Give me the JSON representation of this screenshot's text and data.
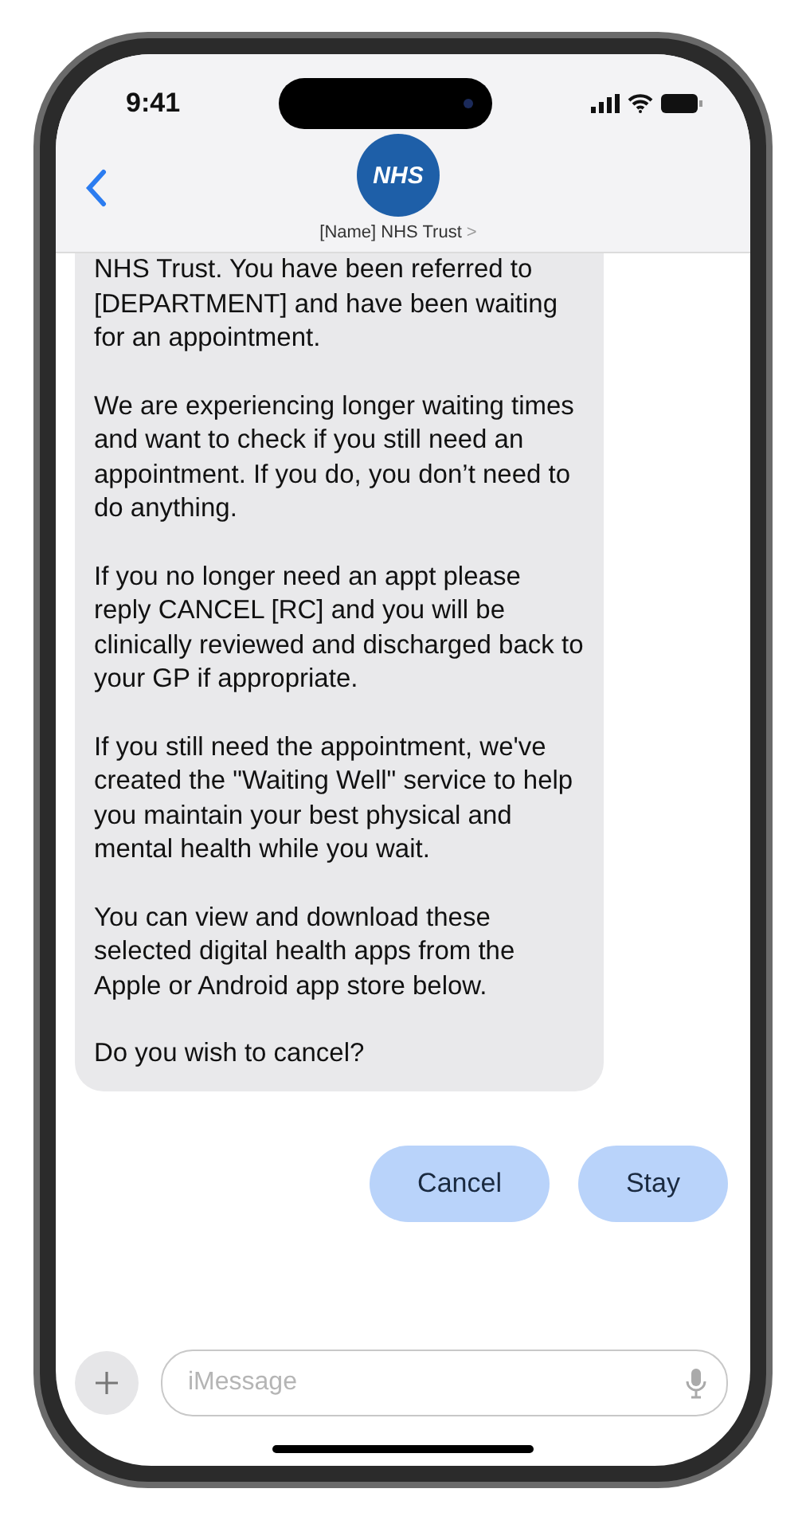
{
  "status_bar": {
    "time": "9:41"
  },
  "header": {
    "avatar_text": "NHS",
    "contact": "[Name] NHS Trust",
    "chevron": ">"
  },
  "message": {
    "paragraphs": [
      "NHS Trust. You have been referred to [DEPARTMENT] and have been waiting for an appointment.",
      "We are experiencing longer waiting times and want to check if you still need an appointment. If you do, you don’t need to do anything.",
      "If you no longer need an appt please reply CANCEL [RC] and you will be clinically reviewed and discharged back to your GP if appropriate.",
      "If you still need the appointment, we've created the \"Waiting Well\" service to help you maintain your best physical and mental health while you wait.",
      "You can view and download these selected digital health apps from the Apple or Android app store below.",
      "Do you wish to cancel?"
    ]
  },
  "quick_replies": [
    "Cancel",
    "Stay"
  ],
  "composer": {
    "placeholder": "iMessage"
  }
}
